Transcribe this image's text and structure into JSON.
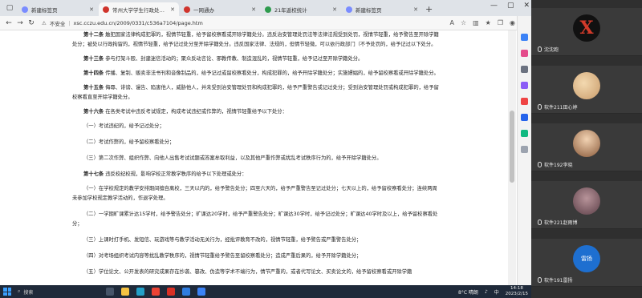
{
  "tabs": [
    {
      "label": "新建标签页",
      "color": "#7a8cff",
      "active": false
    },
    {
      "label": "常州大学学生行政处分（校理）",
      "color": "#d0342c",
      "active": true
    },
    {
      "label": "一网通办",
      "color": "#d0342c",
      "active": false
    },
    {
      "label": "21年返校统计",
      "color": "#2e9b4e",
      "active": false
    },
    {
      "label": "新建标签页",
      "color": "#7a8cff",
      "active": false
    }
  ],
  "address": {
    "security": "不安全",
    "url": "xsc.cczu.edu.cn/2009/0331/c536a7104/page.htm"
  },
  "document": {
    "paragraphs": [
      {
        "lead": "第十二条",
        "text": "触犯国家法律构成犯罪的，视情节轻重，给予留校察看或开除学籍处分。违反治安管理处罚法等法律法规受到处罚，视情节轻重，给予警告至开除学籍处分；被处以行政拘留的，视情节轻重，给予记过处分至开除学籍处分。违反国家法律、法规的，但情节轻微，可以依行政部门（不予处罚的，给予记过以下处分。"
      },
      {
        "lead": "第十三条",
        "text": "参与打架斗殴、封建迷信活动的；聚众反动言论、邪教传教、制造混乱的，视情节轻重，给予记过至开除学籍处分。"
      },
      {
        "lead": "第十四条",
        "text": "传播、复制、贩卖非法书刊和音像制品的，给予记过或留校察看处分，构成犯罪的，给予开除学籍处分；实施嫖娼的，给予留校察看或开除学籍处分。"
      },
      {
        "lead": "第十五条",
        "text": "侮辱、诽谤、谩告、陷害他人，威胁他人，并未受到治安管理处罚和构成犯罪的，给予严重警告或记过处分；受到治安管理处罚或构成犯罪的，给予留校察看直至开除学籍处分。"
      },
      {
        "lead": "第十六条",
        "text": "在各类考试中违反考试规定，构成考试违纪或作弊的，视情节轻重给予以下处分："
      }
    ],
    "items": [
      "（一）考试违纪的，给予记过处分；",
      "（二）考试作弊的，给予留校察看处分；",
      "（三）第二次作弊、组织作弊、向他人出售考试试题或答案牟取利益，以及其他严重作弊或扰乱考试秩序行为的，给予开除学籍处分。"
    ],
    "article17": {
      "lead": "第十七条",
      "text": "违反校纪校规，影响学校正常教学秩序的给予以下处理或处分："
    },
    "items17": [
      "（一）在学校规定的教学安排期间擅自离校，三天以内的，给予警告处分；四至六天的，给予严重警告至记过处分；七天以上的，给予留校察看处分；连续两周未参加学校规定教学活动的，作退学处理。",
      "（二）一学期旷课累计达15学时，给予警告处分；旷课达20学时，给予严重警告处分；旷课达30学时，给予记过处分；旷课达40学时及以上，给予留校察看处分；",
      "（三）上课时打手机、发短信、玩游戏等与教学活动无关行为，经批评教育不改的，视情节轻重，给予警告或严重警告处分；",
      "（四）对考场组织考试内容等扰乱教学秩序的，视情节轻重给予警告至留校察看处分；造成严重后果的，给予开除学籍处分；",
      "（五）学位论文、公开发表的研究成果存在抄袭、篡改、伪造等学术不端行为，情节严重的，或者代写论文、买卖论文的，给予留校察看或开除学籍"
    ]
  },
  "participants": [
    {
      "name": "沈沈跑",
      "initial": "X",
      "bg": "#111111",
      "fg": "#d23a2a"
    },
    {
      "name": "软件211田心婷",
      "initial": "",
      "bg": "#d8b07a",
      "fg": "#ffffff"
    },
    {
      "name": "软件192李晓",
      "initial": "",
      "bg": "#c98a52",
      "fg": "#ffffff"
    },
    {
      "name": "软件221赵雨博",
      "initial": "",
      "bg": "#8d6a72",
      "fg": "#ffffff"
    },
    {
      "name": "软件191雷扬",
      "initial": "雷扬",
      "bg": "#1e6fd0",
      "fg": "#ffffff"
    }
  ],
  "taskbar": {
    "search_label": "搜索",
    "weather": "8°C 晴朗",
    "time": "14:18",
    "date": "2023/2/15",
    "lang": "中"
  }
}
